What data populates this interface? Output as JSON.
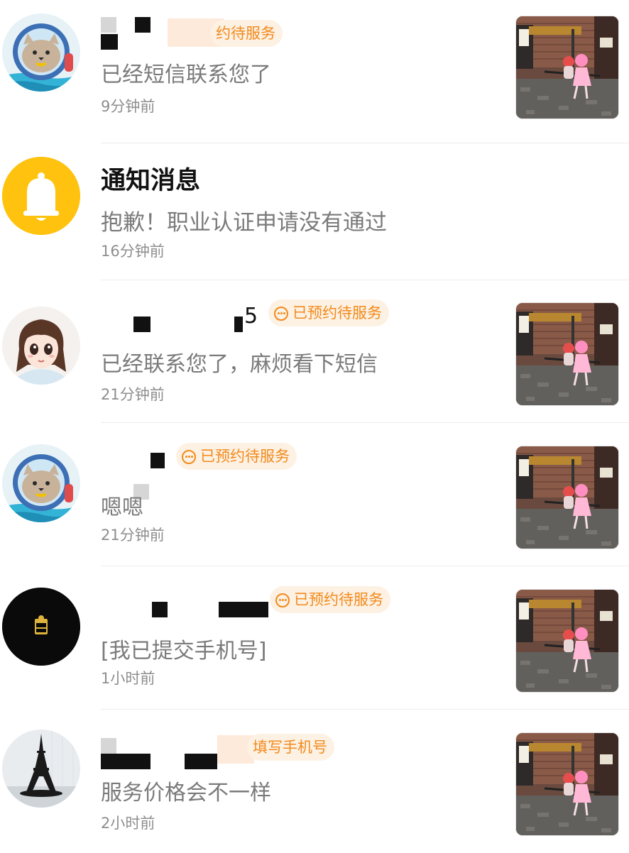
{
  "conversations": [
    {
      "avatar": "cat-astronaut-avatar",
      "badge": "约待服务",
      "preview": "已经短信联系您了",
      "time": "9分钟前",
      "thumbnail": "street-swing-photo"
    },
    {
      "avatar": "bell-icon",
      "name": "通知消息",
      "preview": "抱歉！职业认证申请没有通过",
      "time": "16分钟前"
    },
    {
      "avatar": "cartoon-girl-avatar",
      "name_fragment": "5",
      "badge": "已预约待服务",
      "preview": "已经联系您了，麻烦看下短信",
      "time": "21分钟前",
      "thumbnail": "street-swing-photo"
    },
    {
      "avatar": "cat-astronaut-avatar",
      "badge": "已预约待服务",
      "preview": "嗯嗯",
      "time": "21分钟前",
      "thumbnail": "street-swing-photo"
    },
    {
      "avatar": "black-circle-logo-avatar",
      "badge": "已预约待服务",
      "preview": "[我已提交手机号]",
      "time": "1小时前",
      "thumbnail": "street-swing-photo"
    },
    {
      "avatar": "eiffel-tower-avatar",
      "badge": "填写手机号",
      "preview": "服务价格会不一样",
      "time": "2小时前",
      "thumbnail": "street-swing-photo"
    }
  ],
  "colors": {
    "badge_text": "#f28a1c",
    "badge_bg": "#fdf1e3",
    "bell_bg": "#ffc20e",
    "name": "#111111",
    "preview": "#7a7a7a",
    "time": "#8e8e8e"
  }
}
